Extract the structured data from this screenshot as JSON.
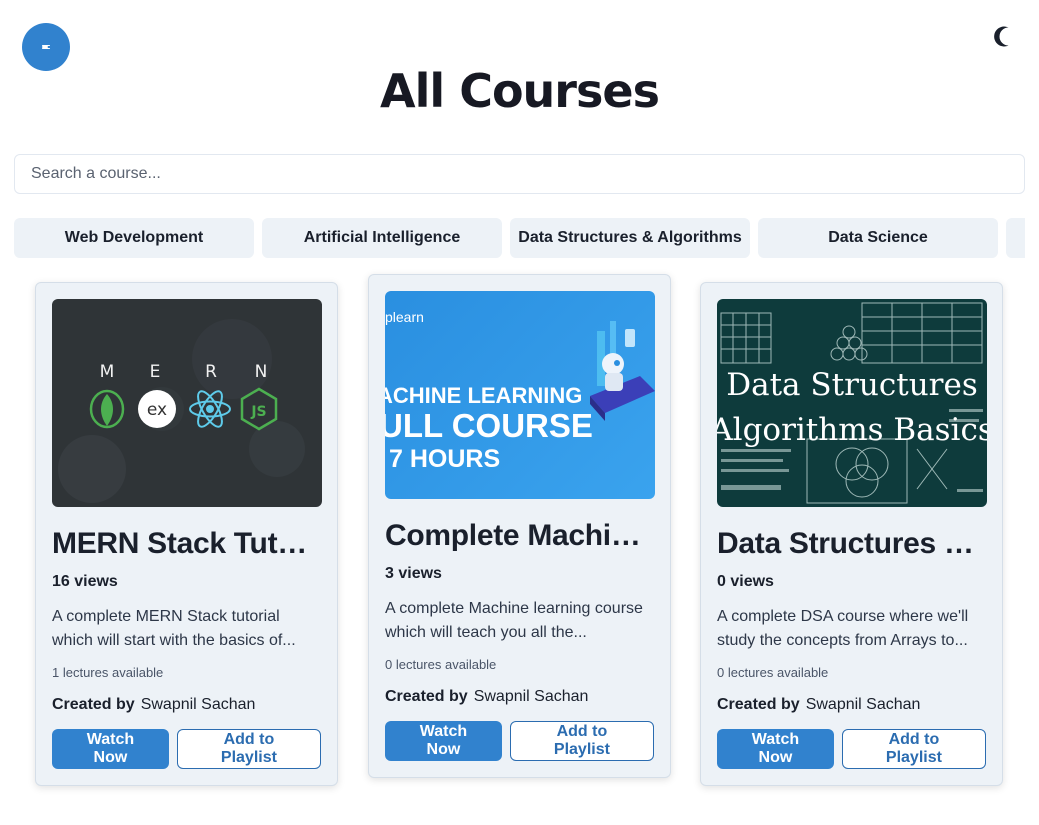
{
  "header": {
    "title": "All Courses",
    "menu_icon": "menu-lines-icon",
    "theme_icon": "moon-icon"
  },
  "search": {
    "placeholder": "Search a course...",
    "value": ""
  },
  "categories": [
    "Web Development",
    "Artificial Intelligence",
    "Data Structures & Algorithms",
    "Data Science",
    ""
  ],
  "courses": [
    {
      "title": "MERN Stack Tutorial",
      "views": "16 views",
      "description": "A complete MERN Stack tutorial which will start with the basics of...",
      "lectures": "1 lectures available",
      "created_by_label": "Created by",
      "creator": "Swapnil Sachan",
      "watch_label": "Watch Now",
      "playlist_label": "Add to Playlist",
      "thumb": {
        "letters": [
          "M",
          "E",
          "R",
          "N"
        ],
        "ex_label": "ex",
        "js_label": "JS"
      }
    },
    {
      "title": "Complete Machine Learning",
      "views": "3 views",
      "description": "A complete Machine learning course which will teach you all the...",
      "lectures": "0 lectures available",
      "created_by_label": "Created by",
      "creator": "Swapnil Sachan",
      "watch_label": "Watch Now",
      "playlist_label": "Add to Playlist",
      "thumb": {
        "brand": "plearn",
        "line1": "ACHINE LEARNING",
        "line2": "ULL COURSE",
        "line3": "7 HOURS"
      }
    },
    {
      "title": "Data Structures & Algorithms",
      "views": "0 views",
      "description": "A complete DSA course where we'll study the concepts from Arrays to...",
      "lectures": "0 lectures available",
      "created_by_label": "Created by",
      "creator": "Swapnil Sachan",
      "watch_label": "Watch Now",
      "playlist_label": "Add to Playlist",
      "thumb": {
        "line1": "Data Structures",
        "line2": "Algorithms Basics"
      }
    }
  ],
  "colors": {
    "accent": "#3182ce",
    "card_bg": "#edf2f7",
    "ml_blue": "#2a8fe0",
    "dsa_bg": "#0e3b3c"
  }
}
